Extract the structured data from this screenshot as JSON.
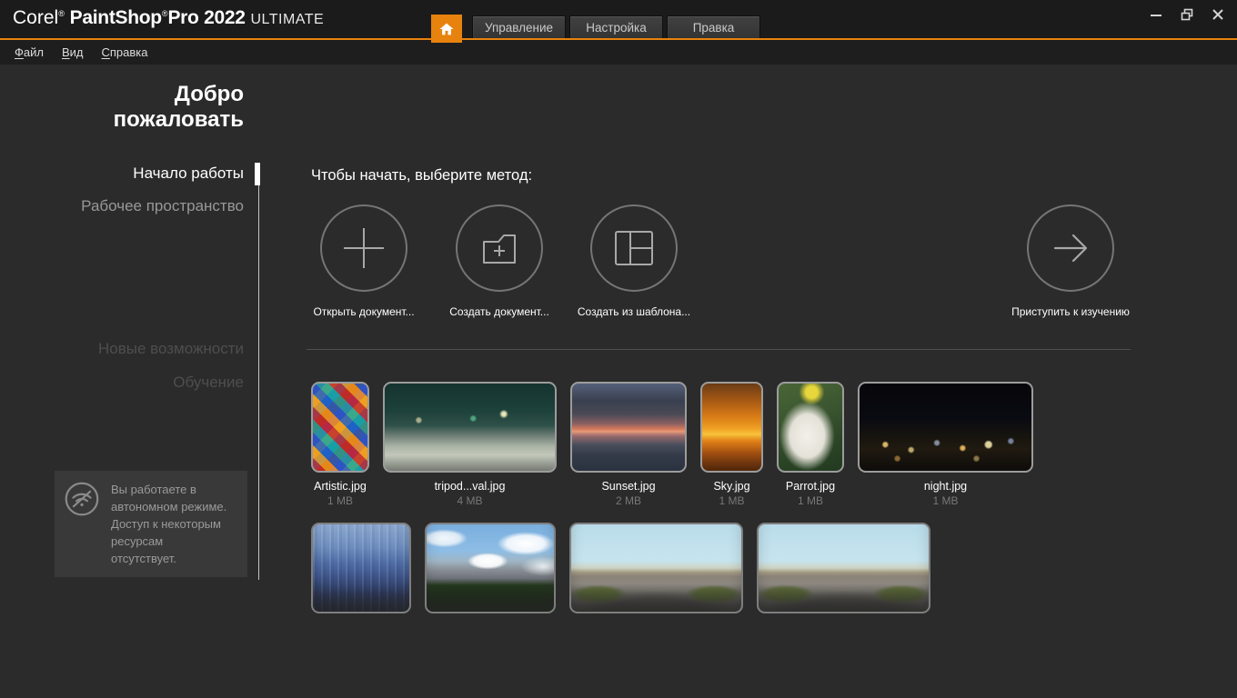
{
  "titlebar": {
    "brand": "Corel",
    "reg": "®",
    "product": "PaintShop",
    "product_suffix": "Pro 2022",
    "edition": "ULTIMATE",
    "tabs": [
      {
        "label": "Управление"
      },
      {
        "label": "Настройка"
      },
      {
        "label": "Правка"
      }
    ],
    "icons": {
      "home": "home-icon",
      "minimize": "minimize-icon",
      "restore": "restore-icon",
      "close": "close-icon"
    }
  },
  "menubar": {
    "items": [
      {
        "accel": "Ф",
        "rest": "айл"
      },
      {
        "accel": "В",
        "rest": "ид"
      },
      {
        "accel": "С",
        "rest": "правка"
      }
    ]
  },
  "sidebar": {
    "title": "Добро пожаловать",
    "items": [
      {
        "label": "Начало работы",
        "state": "active"
      },
      {
        "label": "Рабочее пространство",
        "state": "normal"
      },
      {
        "label": "Новые возможности",
        "state": "disabled"
      },
      {
        "label": "Обучение",
        "state": "disabled"
      }
    ],
    "offline_notice": "Вы работаете в автономном режиме. Доступ к некоторым ресурсам отсутствует.",
    "offline_icon": "wifi-off-icon"
  },
  "main": {
    "heading": "Чтобы начать, выберите метод:",
    "start_methods": [
      {
        "label": "Открыть документ...",
        "icon": "plus-icon"
      },
      {
        "label": "Создать документ...",
        "icon": "folder-plus-icon"
      },
      {
        "label": "Создать из шаблона...",
        "icon": "template-icon"
      },
      {
        "label": "Приступить к изучению",
        "icon": "arrow-right-icon"
      }
    ],
    "recent_files": [
      {
        "name": "Artistic.jpg",
        "size": "1 MB",
        "style": "th-artistic"
      },
      {
        "name": "tripod...val.jpg",
        "size": "4 MB",
        "style": "th-tripod"
      },
      {
        "name": "Sunset.jpg",
        "size": "2 MB",
        "style": "th-sunset"
      },
      {
        "name": "Sky.jpg",
        "size": "1 MB",
        "style": "th-sky"
      },
      {
        "name": "Parrot.jpg",
        "size": "1 MB",
        "style": "th-parrot"
      },
      {
        "name": "night.jpg",
        "size": "1 MB",
        "style": "th-night"
      }
    ],
    "recent_files_row2": [
      {
        "style": "th-painting"
      },
      {
        "style": "th-mountain"
      },
      {
        "style": "th-pano"
      },
      {
        "style": "th-pano2"
      }
    ]
  },
  "colors": {
    "accent": "#e8820e",
    "background": "#2b2b2b",
    "titlebar": "#1b1b1b"
  }
}
